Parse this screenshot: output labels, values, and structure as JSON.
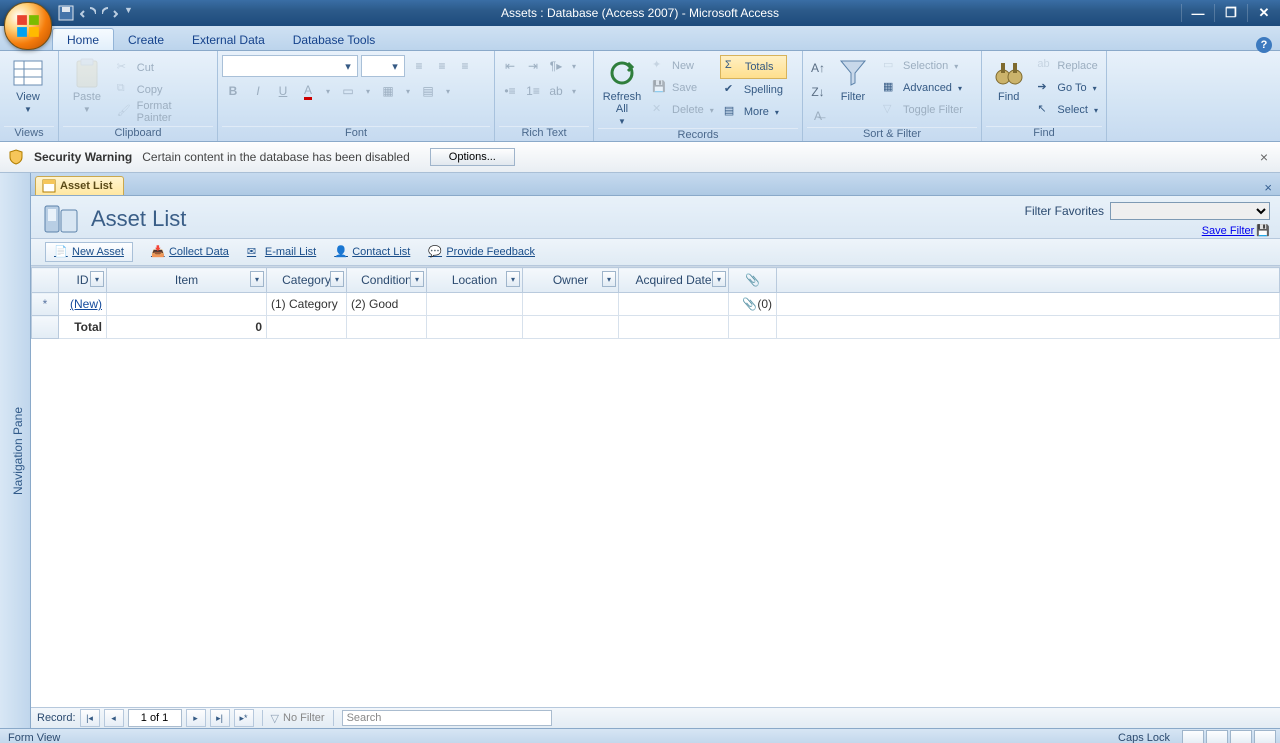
{
  "title": "Assets : Database (Access 2007) - Microsoft Access",
  "tabs": {
    "home": "Home",
    "create": "Create",
    "external": "External Data",
    "dbtools": "Database Tools"
  },
  "ribbon": {
    "views": {
      "big": "View",
      "label": "Views"
    },
    "clipboard": {
      "big": "Paste",
      "cut": "Cut",
      "copy": "Copy",
      "painter": "Format Painter",
      "label": "Clipboard"
    },
    "font": {
      "label": "Font"
    },
    "richtext": {
      "label": "Rich Text"
    },
    "records": {
      "big": "Refresh All",
      "new": "New",
      "save": "Save",
      "delete": "Delete",
      "totals": "Totals",
      "spelling": "Spelling",
      "more": "More",
      "label": "Records"
    },
    "sortfilter": {
      "big": "Filter",
      "selection": "Selection",
      "advanced": "Advanced",
      "toggle": "Toggle Filter",
      "label": "Sort & Filter"
    },
    "find": {
      "big": "Find",
      "replace": "Replace",
      "goto": "Go To",
      "select": "Select",
      "label": "Find"
    }
  },
  "message": {
    "title": "Security Warning",
    "body": "Certain content in the database has been disabled",
    "button": "Options..."
  },
  "navpane": "Navigation Pane",
  "object_tab": "Asset List",
  "form": {
    "title": "Asset List",
    "filter_label": "Filter Favorites",
    "save_filter": "Save Filter",
    "actions": {
      "new": "New Asset",
      "collect": "Collect Data",
      "email": "E-mail List",
      "contact": "Contact List",
      "feedback": "Provide Feedback"
    }
  },
  "columns": [
    "ID",
    "Item",
    "Category",
    "Condition",
    "Location",
    "Owner",
    "Acquired Date"
  ],
  "attach_col": "📎",
  "rows": {
    "new": {
      "id": "(New)",
      "category": "(1) Category",
      "condition": "(2) Good",
      "attach": "📎(0)"
    },
    "total": {
      "label": "Total",
      "item": "0"
    }
  },
  "recnav": {
    "label": "Record:",
    "current": "1 of 1",
    "nofilter": "No Filter",
    "search_placeholder": "Search"
  },
  "status": {
    "left": "Form View",
    "caps": "Caps Lock"
  }
}
